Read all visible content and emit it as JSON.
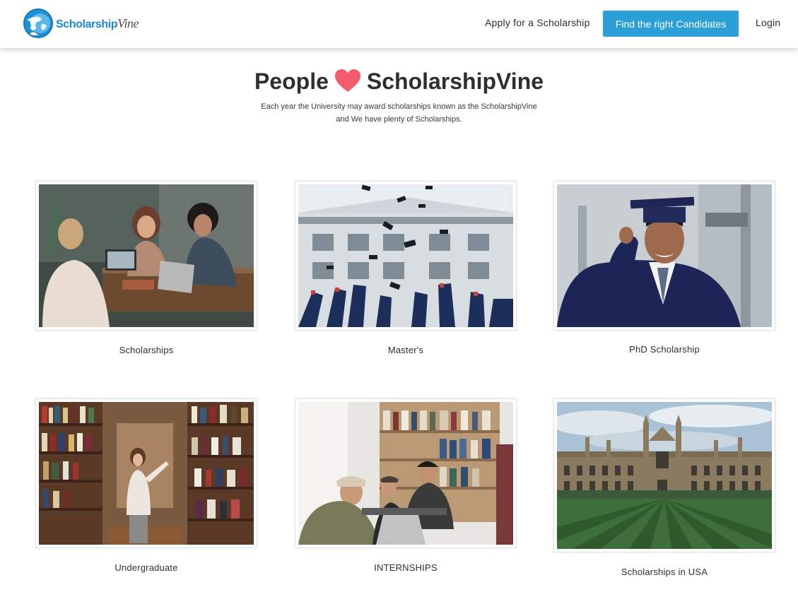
{
  "brand": {
    "name_part1": "Scholarship",
    "name_part2": "Vine",
    "logo_icon": "globe-graduate-icon",
    "color": "#1f92d6"
  },
  "nav": {
    "apply_label": "Apply for a Scholarship",
    "cta_label": "Find the right Candidates",
    "login_label": "Login",
    "cta_color": "#2a9fd8"
  },
  "hero": {
    "title_left": "People",
    "title_right": "ScholarshipVine",
    "heart_icon": "heart-icon",
    "heart_color": "#f25c6c",
    "subtitle_line1": "Each year the University may award scholarships known as the ScholarshipVine",
    "subtitle_line2": "and We have plenty of Scholarships."
  },
  "categories": [
    {
      "label": "Scholarships",
      "image": "students-working-at-cafe-table"
    },
    {
      "label": "Master's",
      "image": "graduates-throwing-caps"
    },
    {
      "label": "PhD Scholarship",
      "image": "graduate-in-cap-and-gown"
    },
    {
      "label": "Undergraduate",
      "image": "student-in-library-aisle"
    },
    {
      "label": "INTERNSHIPS",
      "image": "team-around-laptop"
    },
    {
      "label": "Scholarships in USA",
      "image": "university-building-on-lawn"
    }
  ]
}
